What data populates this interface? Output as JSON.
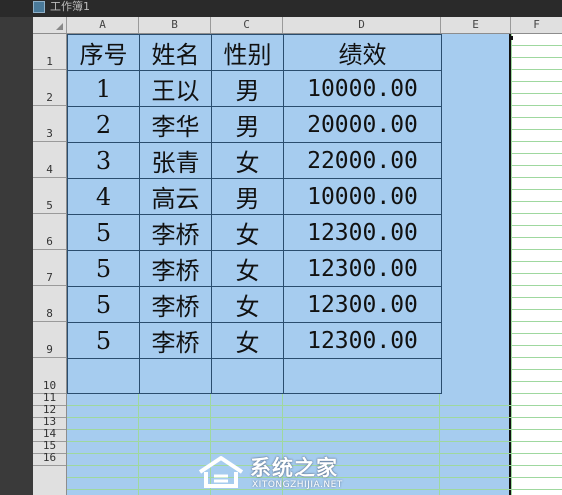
{
  "window": {
    "title": "工作簿1"
  },
  "columns": [
    "A",
    "B",
    "C",
    "D",
    "E",
    "F"
  ],
  "rows": [
    "1",
    "2",
    "3",
    "4",
    "5",
    "6",
    "7",
    "8",
    "9",
    "10",
    "11",
    "12",
    "13",
    "14",
    "15",
    "16"
  ],
  "table": [
    [
      "序号",
      "姓名",
      "性别",
      "绩效"
    ],
    [
      "1",
      "王以",
      "男",
      "10000.00"
    ],
    [
      "2",
      "李华",
      "男",
      "20000.00"
    ],
    [
      "3",
      "张青",
      "女",
      "22000.00"
    ],
    [
      "4",
      "高云",
      "男",
      "10000.00"
    ],
    [
      "5",
      "李桥",
      "女",
      "12300.00"
    ],
    [
      "5",
      "李桥",
      "女",
      "12300.00"
    ],
    [
      "5",
      "李桥",
      "女",
      "12300.00"
    ],
    [
      "5",
      "李桥",
      "女",
      "12300.00"
    ],
    [
      "",
      "",
      "",
      ""
    ]
  ],
  "watermark": {
    "name": "系统之家",
    "url": "XITONGZHIJIA.NET"
  },
  "colors": {
    "selection": "#a6ccef",
    "gridline": "#9fd89f",
    "header": "#e0e0e0"
  }
}
